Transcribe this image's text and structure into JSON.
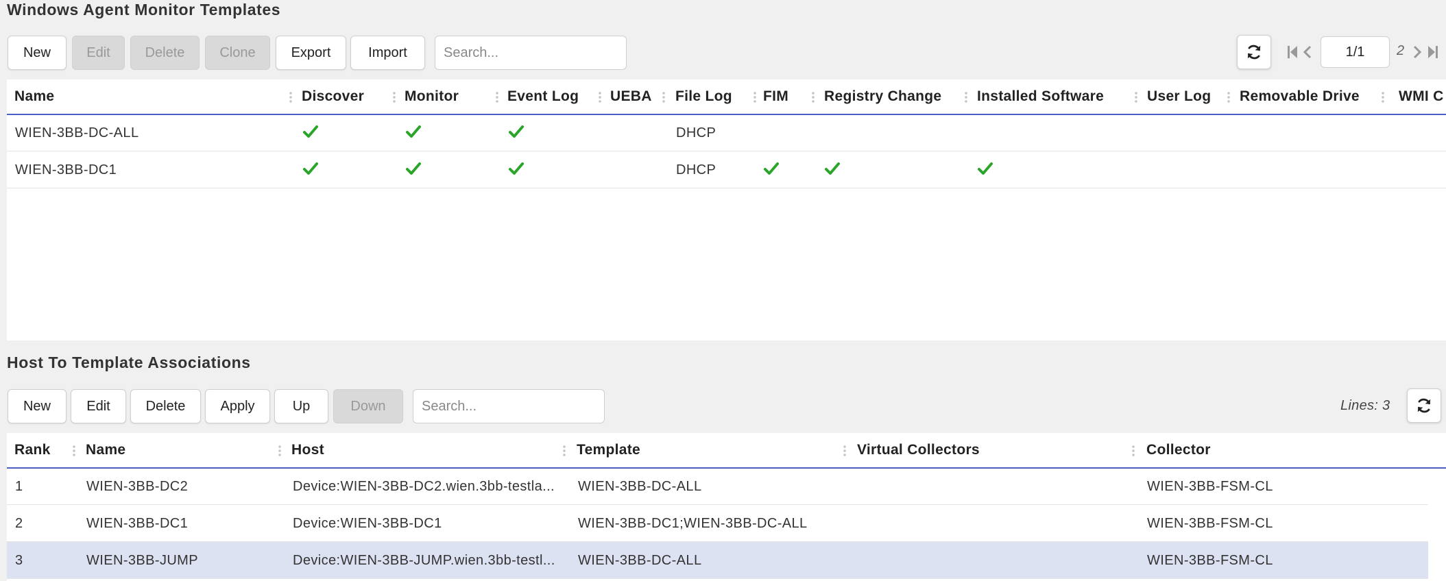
{
  "templates": {
    "title": "Windows Agent Monitor Templates",
    "toolbar": {
      "new": "New",
      "edit": "Edit",
      "delete": "Delete",
      "clone": "Clone",
      "export": "Export",
      "import": "Import",
      "search_placeholder": "Search..."
    },
    "pager": {
      "page": "1/1",
      "count": "2"
    },
    "columns": [
      "Name",
      "Discover",
      "Monitor",
      "Event Log",
      "UEBA",
      "File Log",
      "FIM",
      "Registry Change",
      "Installed Software",
      "User Log",
      "Removable Drive",
      "WMI C"
    ],
    "rows": [
      {
        "name": "WIEN-3BB-DC-ALL",
        "discover": true,
        "monitor": true,
        "event_log": true,
        "file_log": "DHCP",
        "fim": false,
        "registry_change": false,
        "installed_software": false
      },
      {
        "name": "WIEN-3BB-DC1",
        "discover": true,
        "monitor": true,
        "event_log": true,
        "file_log": "DHCP",
        "fim": true,
        "registry_change": true,
        "installed_software": true
      }
    ]
  },
  "associations": {
    "title": "Host To Template Associations",
    "toolbar": {
      "new": "New",
      "edit": "Edit",
      "delete": "Delete",
      "apply": "Apply",
      "up": "Up",
      "down": "Down",
      "search_placeholder": "Search..."
    },
    "lines": "Lines: 3",
    "columns": [
      "Rank",
      "Name",
      "Host",
      "Template",
      "Virtual Collectors",
      "Collector"
    ],
    "rows": [
      {
        "rank": "1",
        "name": "WIEN-3BB-DC2",
        "host": "Device:WIEN-3BB-DC2.wien.3bb-testla...",
        "template": "WIEN-3BB-DC-ALL",
        "virtual_collectors": "",
        "collector": "WIEN-3BB-FSM-CL"
      },
      {
        "rank": "2",
        "name": "WIEN-3BB-DC1",
        "host": "Device:WIEN-3BB-DC1",
        "template": "WIEN-3BB-DC1;WIEN-3BB-DC-ALL",
        "virtual_collectors": "",
        "collector": "WIEN-3BB-FSM-CL"
      },
      {
        "rank": "3",
        "name": "WIEN-3BB-JUMP",
        "host": "Device:WIEN-3BB-JUMP.wien.3bb-testl...",
        "template": "WIEN-3BB-DC-ALL",
        "virtual_collectors": "",
        "collector": "WIEN-3BB-FSM-CL",
        "selected": true
      }
    ]
  },
  "colors": {
    "accent": "#4a5fc1",
    "check": "#2aa52a",
    "selected_row": "#dde2f3"
  },
  "icons": {
    "refresh": "refresh-icon",
    "first": "first-page-icon",
    "prev": "prev-page-icon",
    "next": "next-page-icon",
    "last": "last-page-icon",
    "check": "checkmark-icon"
  }
}
